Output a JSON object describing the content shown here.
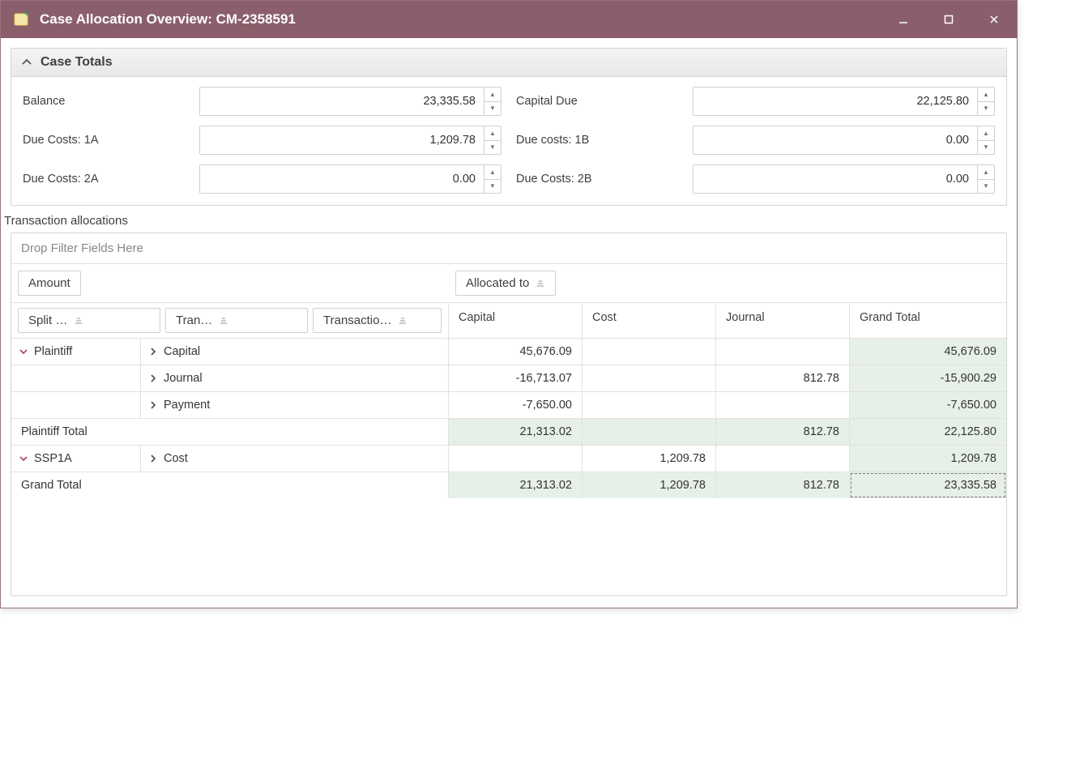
{
  "window": {
    "title": "Case Allocation Overview: CM-2358591"
  },
  "panel": {
    "title": "Case Totals",
    "fields": {
      "balance_label": "Balance",
      "balance_value": "23,335.58",
      "capital_due_label": "Capital Due",
      "capital_due_value": "22,125.80",
      "due_costs_1a_label": "Due Costs: 1A",
      "due_costs_1a_value": "1,209.78",
      "due_costs_1b_label": "Due costs: 1B",
      "due_costs_1b_value": "0.00",
      "due_costs_2a_label": "Due Costs: 2A",
      "due_costs_2a_value": "0.00",
      "due_costs_2b_label": "Due Costs: 2B",
      "due_costs_2b_value": "0.00"
    }
  },
  "section_label": "Transaction allocations",
  "pivot": {
    "filter_placeholder": "Drop Filter Fields Here",
    "data_field_chip": "Amount",
    "column_field_chip": "Allocated to",
    "row_field_chips": [
      "Split …",
      "Tran…",
      "Transactio…"
    ],
    "col_headers": [
      "Capital",
      "Cost",
      "Journal",
      "Grand Total"
    ],
    "rows": [
      {
        "kind": "group-first",
        "r1": "Plaintiff",
        "r2": "Capital",
        "cells": [
          "45,676.09",
          "",
          "",
          "45,676.09"
        ]
      },
      {
        "kind": "group-sub",
        "r2": "Journal",
        "cells": [
          "-16,713.07",
          "",
          "812.78",
          "-15,900.29"
        ]
      },
      {
        "kind": "group-sub",
        "r2": "Payment",
        "cells": [
          "-7,650.00",
          "",
          "",
          "-7,650.00"
        ]
      },
      {
        "kind": "subtotal",
        "label": "Plaintiff Total",
        "cells": [
          "21,313.02",
          "",
          "812.78",
          "22,125.80"
        ]
      },
      {
        "kind": "group-first",
        "r1": "SSP1A",
        "r2": "Cost",
        "cells": [
          "",
          "1,209.78",
          "",
          "1,209.78"
        ]
      },
      {
        "kind": "grandtotal",
        "label": "Grand Total",
        "cells": [
          "21,313.02",
          "1,209.78",
          "812.78",
          "23,335.58"
        ]
      }
    ]
  }
}
